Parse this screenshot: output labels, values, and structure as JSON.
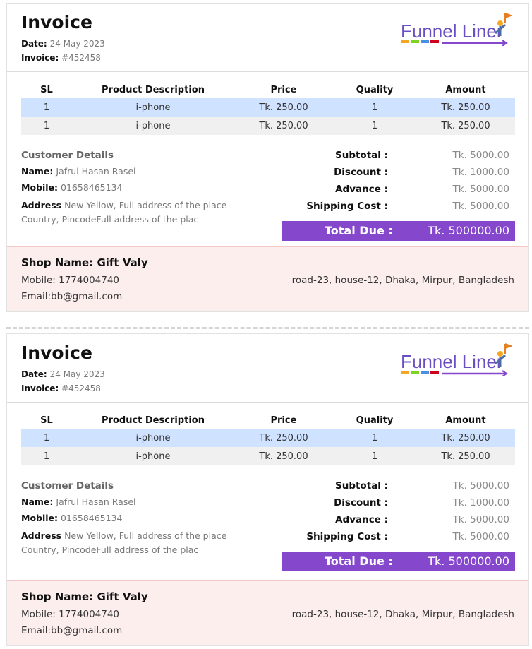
{
  "invoices": [
    {
      "title": "Invoice",
      "date_label": "Date:",
      "date": "24 May 2023",
      "invoice_label": "Invoice:",
      "invoice_no": "#452458",
      "logo_text": "Funnel Liner",
      "table": {
        "headers": [
          "SL",
          "Product Description",
          "Price",
          "Quality",
          "Amount"
        ],
        "rows": [
          [
            "1",
            "i-phone",
            "Tk. 250.00",
            "1",
            "Tk. 250.00"
          ],
          [
            "1",
            "i-phone",
            "Tk. 250.00",
            "1",
            "Tk. 250.00"
          ]
        ]
      },
      "customer": {
        "heading": "Customer Details",
        "name_label": "Name:",
        "name": "Jafrul Hasan Rasel",
        "mobile_label": "Mobile:",
        "mobile": "01658465134",
        "address_label": "Address",
        "address": "New Yellow, Full address of the place Country, PincodeFull address of the plac"
      },
      "summary": {
        "subtotal_label": "Subtotal :",
        "subtotal": "Tk. 5000.00",
        "discount_label": "Discount :",
        "discount": "Tk. 1000.00",
        "advance_label": "Advance :",
        "advance": "Tk. 5000.00",
        "shipping_label": "Shipping Cost :",
        "shipping": "Tk. 5000.00",
        "total_label": "Total Due :",
        "total": "Tk. 500000.00"
      },
      "shop": {
        "name": "Shop Name: Gift Valy",
        "mobile": "Mobile: 1774004740",
        "email": "Email:bb@gmail.com",
        "address": "road-23, house-12, Dhaka, Mirpur, Bangladesh"
      }
    },
    {
      "title": "Invoice",
      "date_label": "Date:",
      "date": "24 May 2023",
      "invoice_label": "Invoice:",
      "invoice_no": "#452458",
      "logo_text": "Funnel Liner",
      "table": {
        "headers": [
          "SL",
          "Product Description",
          "Price",
          "Quality",
          "Amount"
        ],
        "rows": [
          [
            "1",
            "i-phone",
            "Tk. 250.00",
            "1",
            "Tk. 250.00"
          ],
          [
            "1",
            "i-phone",
            "Tk. 250.00",
            "1",
            "Tk. 250.00"
          ]
        ]
      },
      "customer": {
        "heading": "Customer Details",
        "name_label": "Name:",
        "name": "Jafrul Hasan Rasel",
        "mobile_label": "Mobile:",
        "mobile": "01658465134",
        "address_label": "Address",
        "address": "New Yellow, Full address of the place Country, PincodeFull address of the plac"
      },
      "summary": {
        "subtotal_label": "Subtotal :",
        "subtotal": "Tk. 5000.00",
        "discount_label": "Discount :",
        "discount": "Tk. 1000.00",
        "advance_label": "Advance :",
        "advance": "Tk. 5000.00",
        "shipping_label": "Shipping Cost :",
        "shipping": "Tk. 5000.00",
        "total_label": "Total Due :",
        "total": "Tk. 500000.00"
      },
      "shop": {
        "name": "Shop Name: Gift Valy",
        "mobile": "Mobile: 1774004740",
        "email": "Email:bb@gmail.com",
        "address": "road-23, house-12, Dhaka, Mirpur, Bangladesh"
      }
    }
  ],
  "colors": {
    "accent": "#8547cb",
    "row_highlight": "#cfe2ff",
    "row_alt": "#f0f0f0",
    "shop_bg": "#fdeeee"
  }
}
